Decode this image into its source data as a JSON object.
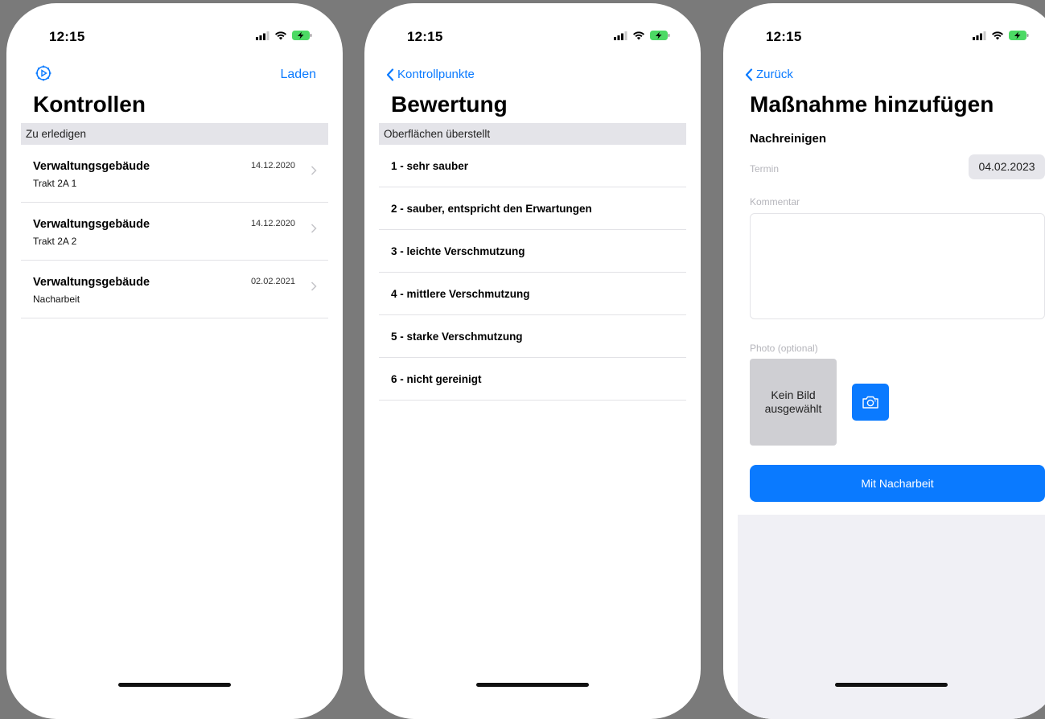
{
  "status_time": "12:15",
  "colors": {
    "accent": "#0a7aff",
    "section_bg": "#e4e4e9",
    "background": "#7a7a7a"
  },
  "screens": [
    {
      "nav": {
        "left_icon": "gear-icon",
        "right_label": "Laden"
      },
      "title": "Kontrollen",
      "section": "Zu erledigen",
      "items": [
        {
          "title": "Verwaltungsgebäude",
          "subtitle": "Trakt 2A 1",
          "date": "14.12.2020"
        },
        {
          "title": "Verwaltungsgebäude",
          "subtitle": "Trakt 2A 2",
          "date": "14.12.2020"
        },
        {
          "title": "Verwaltungsgebäude",
          "subtitle": "Nacharbeit",
          "date": "02.02.2021"
        }
      ]
    },
    {
      "nav": {
        "back_label": "Kontrollpunkte"
      },
      "title": "Bewertung",
      "section": "Oberflächen überstellt",
      "options": [
        "1 - sehr sauber",
        "2 - sauber, entspricht den Erwartungen",
        "3 - leichte Verschmutzung",
        "4 - mittlere Verschmutzung",
        "5 - starke Verschmutzung",
        "6 - nicht gereinigt"
      ]
    },
    {
      "nav": {
        "back_label": "Zurück"
      },
      "title": "Maßnahme hinzufügen",
      "subtitle": "Nachreinigen",
      "date_label": "Termin",
      "date_value": "04.02.2023",
      "comment_label": "Kommentar",
      "comment_value": "",
      "photo_label": "Photo (optional)",
      "photo_placeholder_line1": "Kein Bild",
      "photo_placeholder_line2": "ausgewählt",
      "camera_icon": "camera-icon",
      "submit_label": "Mit Nacharbeit"
    }
  ]
}
